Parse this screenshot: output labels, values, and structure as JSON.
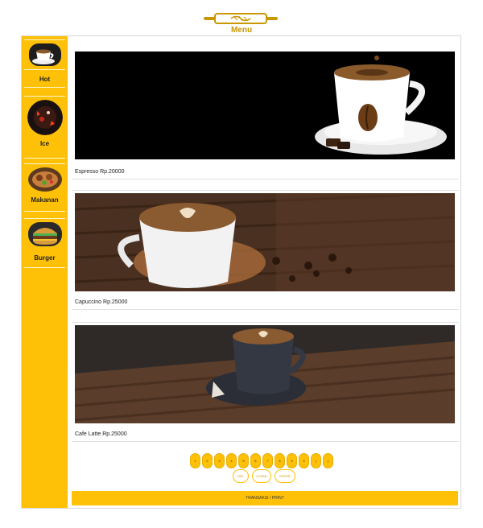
{
  "header": {
    "title": "Menu"
  },
  "colors": {
    "accent": "#ffc107",
    "accent_dark": "#c99700",
    "border": "#d8d8d8"
  },
  "sidebar": {
    "items": [
      {
        "label": "Hot",
        "icon": "hot-coffee-icon"
      },
      {
        "label": "Ice",
        "icon": "ice-drink-icon"
      },
      {
        "label": "Makanan",
        "icon": "food-plate-icon"
      },
      {
        "label": "Burger",
        "icon": "burger-icon"
      }
    ]
  },
  "products": [
    {
      "caption": "Espresso Rp.20000",
      "image": "espresso-photo"
    },
    {
      "caption": "Capuccino Rp.25000",
      "image": "cappuccino-photo"
    },
    {
      "caption": "Cafe Latte Rp.25000",
      "image": "cafe-latte-photo"
    }
  ],
  "keypad": {
    "keys": [
      "1",
      "2",
      "3",
      "4",
      "5",
      "6",
      "7",
      "8",
      "9",
      "0",
      "(",
      ")"
    ],
    "actions": [
      "DEL",
      "CLEAR",
      "ENTER"
    ]
  },
  "footer": {
    "button_label": "TRANSAKSI / PRINT"
  }
}
